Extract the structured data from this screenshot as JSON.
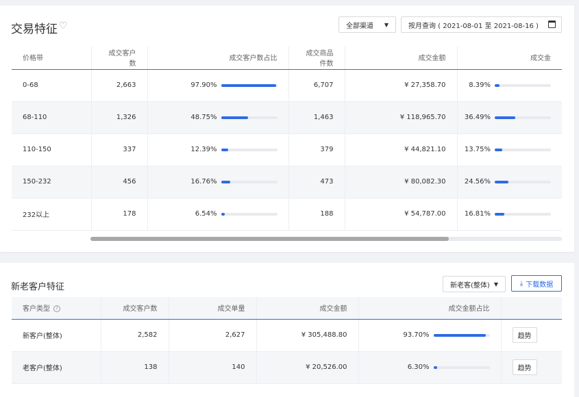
{
  "trade": {
    "title": "交易特征",
    "channel": "全部渠道",
    "date_range": "按月查询 ( 2021-08-01 至 2021-08-16 )",
    "headers": [
      "价格带",
      "成交客户数",
      "成交客户数占比",
      "成交商品件数",
      "成交金额",
      "成交金"
    ],
    "rows": [
      {
        "price": "0-68",
        "customers": "2,663",
        "cust_pct": "97.90%",
        "cust_frac": 0.979,
        "items": "6,707",
        "amount": "¥ 27,358.70",
        "amt_pct": "8.39%",
        "amt_frac": 0.0839
      },
      {
        "price": "68-110",
        "customers": "1,326",
        "cust_pct": "48.75%",
        "cust_frac": 0.4875,
        "items": "1,463",
        "amount": "¥ 118,965.70",
        "amt_pct": "36.49%",
        "amt_frac": 0.3649
      },
      {
        "price": "110-150",
        "customers": "337",
        "cust_pct": "12.39%",
        "cust_frac": 0.1239,
        "items": "379",
        "amount": "¥ 44,821.10",
        "amt_pct": "13.75%",
        "amt_frac": 0.1375
      },
      {
        "price": "150-232",
        "customers": "456",
        "cust_pct": "16.76%",
        "cust_frac": 0.1676,
        "items": "473",
        "amount": "¥ 80,082.30",
        "amt_pct": "24.56%",
        "amt_frac": 0.2456
      },
      {
        "price": "232以上",
        "customers": "178",
        "cust_pct": "6.54%",
        "cust_frac": 0.0654,
        "items": "188",
        "amount": "¥ 54,787.00",
        "amt_pct": "16.81%",
        "amt_frac": 0.1681
      }
    ]
  },
  "customer": {
    "title": "新老客户特征",
    "type_select": "新老客(整体)",
    "download_label": "下载数据",
    "headers": [
      "客户类型",
      "成交客户数",
      "成交单量",
      "成交金额",
      "成交金额占比",
      ""
    ],
    "rows": [
      {
        "type": "新客户(整体)",
        "customers": "2,582",
        "orders": "2,627",
        "amount": "¥ 305,488.80",
        "amt_pct": "93.70%",
        "amt_frac": 0.937,
        "action": "趋势"
      },
      {
        "type": "老客户(整体)",
        "customers": "138",
        "orders": "140",
        "amount": "¥ 20,526.00",
        "amt_pct": "6.30%",
        "amt_frac": 0.063,
        "action": "趋势"
      }
    ]
  },
  "colors": {
    "accent": "#2e6be6"
  }
}
